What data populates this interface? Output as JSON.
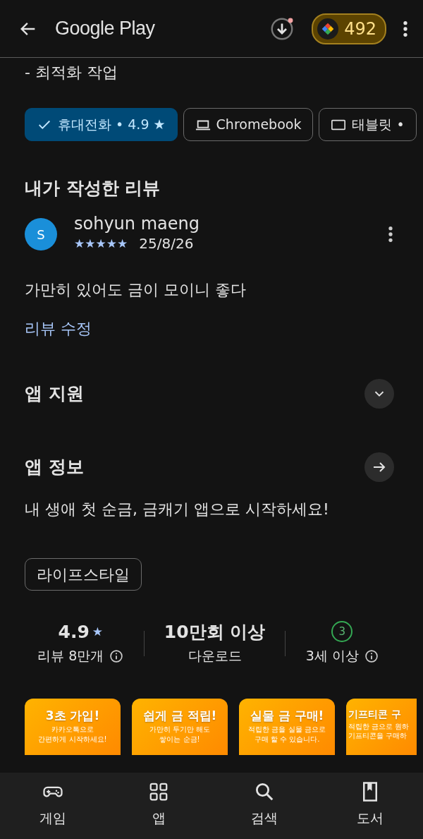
{
  "app_bar": {
    "title": "Google Play",
    "points": "492"
  },
  "description_tail": "- 최적화 작업",
  "device_chips": [
    {
      "kind": "check",
      "label": "휴대전화 • 4.9 ★",
      "selected": true
    },
    {
      "kind": "laptop",
      "label": "Chromebook",
      "selected": false
    },
    {
      "kind": "tablet",
      "label": "태블릿 •",
      "selected": false
    }
  ],
  "my_review": {
    "heading": "내가 작성한 리뷰",
    "avatar_letter": "S",
    "author": "sohyun maeng",
    "stars": 5,
    "date": "25/8/26",
    "text": "가만히 있어도 금이 모이니 좋다",
    "edit_link": "리뷰 수정"
  },
  "sections": [
    {
      "kind": "expand",
      "title": "앱 지원"
    },
    {
      "kind": "arrow",
      "title": "앱 정보"
    }
  ],
  "about": "내 생애 첫 순금, 금캐기 앱으로 시작하세요!",
  "category_chip": "라이프스타일",
  "stats": [
    {
      "kind": "rating",
      "value": "4.9",
      "star": "★",
      "label": "리뷰 8만개",
      "info": true
    },
    {
      "kind": "text",
      "value": "10만회 이상",
      "label": "다운로드",
      "info": false
    },
    {
      "kind": "age",
      "value": "3",
      "label": "3세 이상",
      "info": true
    }
  ],
  "screenshots": [
    {
      "title": "3초 가입!",
      "lines": [
        "카카오톡으로",
        "간편하게 시작하세요!"
      ]
    },
    {
      "title": "쉽게 금 적립!",
      "lines": [
        "가만히 두기만 해도",
        "쌓이는 순금!"
      ]
    },
    {
      "title": "실물 금 구매!",
      "lines": [
        "적립한 금을 실물 금으로",
        "구매 할 수 있습니다."
      ]
    },
    {
      "title": "기프티콘 구",
      "lines": [
        "적립한 금으로 원하",
        "기프티콘을 구매하"
      ]
    }
  ],
  "bottom_nav": [
    {
      "kind": "games",
      "label": "게임"
    },
    {
      "kind": "apps",
      "label": "앱"
    },
    {
      "kind": "search",
      "label": "검색"
    },
    {
      "kind": "books",
      "label": "도서"
    }
  ]
}
